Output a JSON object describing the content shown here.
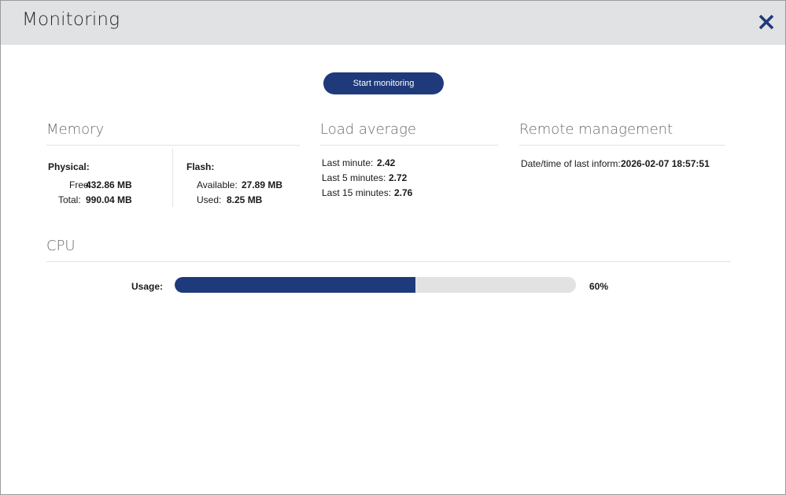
{
  "dialog": {
    "title": "Monitoring",
    "close_icon": "close-icon",
    "accent_color": "#1f3a7a"
  },
  "actions": {
    "start_label": "Start monitoring"
  },
  "memory": {
    "title": "Memory",
    "physical": {
      "heading": "Physical:",
      "free_label": "Free:",
      "free_value": "432.86 MB",
      "total_label": "Total:",
      "total_value": "990.04 MB"
    },
    "flash": {
      "heading": "Flash:",
      "available_label": "Available:",
      "available_value": "27.89 MB",
      "used_label": "Used:",
      "used_value": "8.25 MB"
    }
  },
  "load_average": {
    "title": "Load average",
    "items": [
      {
        "label": "Last minute:",
        "value": "2.42"
      },
      {
        "label": "Last 5 minutes:",
        "value": "2.72"
      },
      {
        "label": "Last 15 minutes:",
        "value": "2.76"
      }
    ]
  },
  "remote": {
    "title": "Remote management",
    "inform_label": "Date/time of last inform:",
    "inform_value": "2026-02-07 18:57:51"
  },
  "cpu": {
    "title": "CPU",
    "usage_label": "Usage:",
    "usage_percent": 60,
    "usage_text": "60%"
  }
}
